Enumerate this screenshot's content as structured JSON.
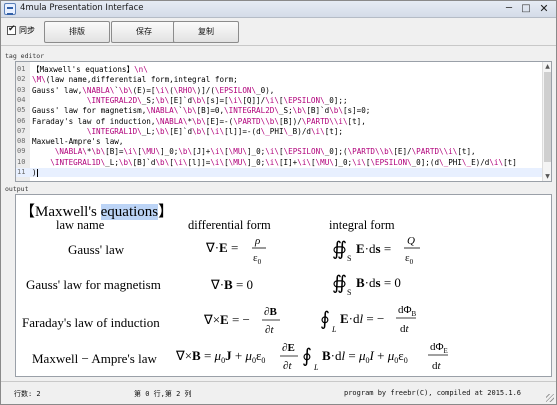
{
  "window": {
    "title": "4mula Presentation Interface",
    "minimize": "─",
    "maximize": "□",
    "close": "✕"
  },
  "toolbar": {
    "sync_label": "同步",
    "sync_checked": true,
    "buttons": [
      "排版",
      "保存",
      "复制"
    ]
  },
  "editor": {
    "section_label": "tag editor",
    "current_line": 11,
    "lines": [
      {
        "n": "01",
        "text": "【Maxwell's equations】\\n\\"
      },
      {
        "n": "02",
        "text": "\\M\\(law name,differential form,integral form;"
      },
      {
        "n": "03",
        "text": "Gauss' law,\\NABLA\\`\\b\\(E)=[\\i\\(\\RHO\\)]/(\\EPSILON\\_0),"
      },
      {
        "n": "04",
        "text": "            \\INTEGRAL2D\\_S;\\b\\[E]`d\\b\\[s]=[\\i\\[Q]]/\\i\\[\\EPSILON\\_0];;"
      },
      {
        "n": "05",
        "text": "Gauss' law for magnetism,\\NABLA\\`\\b\\[B]=0,\\INTEGRAL2D\\_S;\\b\\[B]`d\\b\\[s]=0;"
      },
      {
        "n": "06",
        "text": "Faraday's law of induction,\\NABLA\\*\\b\\[E]=-(\\PARTD\\\\b\\[B])/\\PARTD\\\\i\\[t],"
      },
      {
        "n": "07",
        "text": "            \\INTEGRAL1D\\_L;\\b\\[E]`d\\b\\[\\i\\[l]]=-(d\\_PHI\\_B)/d\\i\\[t];"
      },
      {
        "n": "08",
        "text": "Maxwell-Ampre's law,"
      },
      {
        "n": "09",
        "text": "     \\NABLA\\*\\b\\[B]=\\i\\[\\MU\\]_0;\\b\\[J]+\\i\\[\\MU\\]_0;\\i\\[\\EPSILON\\_0];(\\PARTD\\\\b\\[E]/\\PARTD\\\\i\\[t],"
      },
      {
        "n": "10",
        "text": "    \\INTEGRAL1D\\_L;\\b\\[B]`d\\b\\[\\i\\[l]]=\\i\\[\\MU\\]_0;\\i\\[I]+\\i\\[\\MU\\]_0;\\i\\[\\EPSILON\\_0];(d\\_PHI\\_E)/d\\i\\[t]"
      },
      {
        "n": "11",
        "text": ")"
      }
    ]
  },
  "output": {
    "section_label": "output",
    "title_open": "【Maxwell's ",
    "title_highlight": "equations",
    "title_close": "】",
    "headers": [
      "law name",
      "differential form",
      "integral form"
    ],
    "rows": [
      {
        "name": "Gauss' law",
        "diff": "∇·E = ρ/ε0",
        "int": "∯S E·ds = Q/ε0"
      },
      {
        "name": "Gauss' law for magnetism",
        "diff": "∇·B = 0",
        "int": "∯S B·ds = 0"
      },
      {
        "name": "Faraday's law of induction",
        "diff": "∇×E = −∂B/∂t",
        "int": "∮L E·dl = −dΦB/dt"
      },
      {
        "name": "Maxwell − Ampre's law",
        "diff": "∇×B = μ0J + μ0ε0 ∂E/∂t",
        "int": "∮L B·dl = μ0I + μ0ε0 dΦE/dt"
      }
    ]
  },
  "status": {
    "lines": "行数: 2",
    "position": "第 0 行,第 2 列",
    "credit": "program by freebr(C), compiled at 2015.1.6"
  }
}
